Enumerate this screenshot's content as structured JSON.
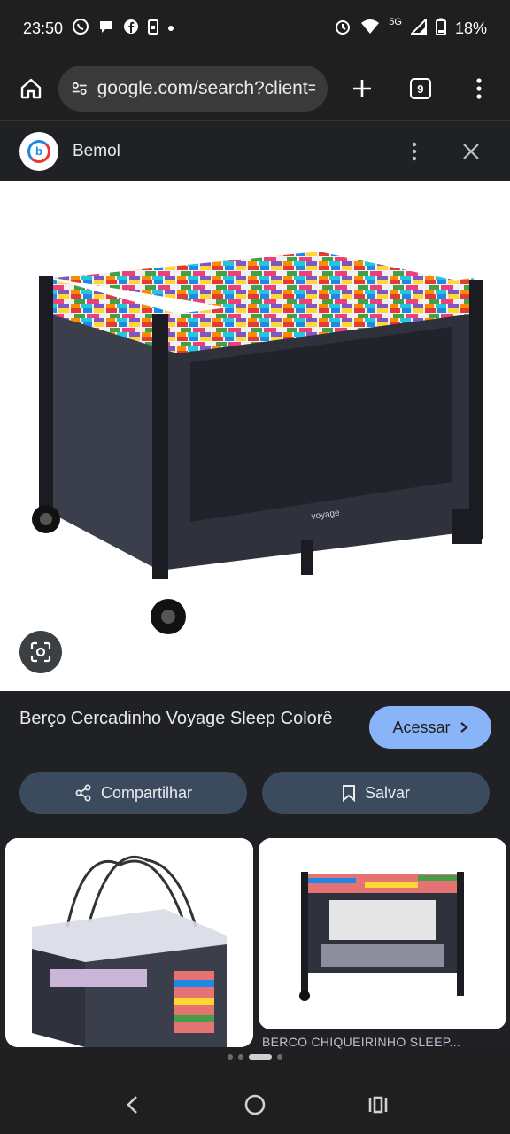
{
  "status": {
    "time": "23:50",
    "network": "5G",
    "battery": "18%"
  },
  "browser": {
    "url": "google.com/search?client=ms",
    "tab_count": "9"
  },
  "source": {
    "name": "Bemol",
    "favicon_letter": "b"
  },
  "result": {
    "title": "Berço Cercadinho Voyage Sleep Colorê",
    "visit_label": "Acessar",
    "share_label": "Compartilhar",
    "save_label": "Salvar",
    "product_brand": "voyage"
  },
  "related": {
    "caption": "BERCO CHIQUEIRINHO SLEEP..."
  },
  "colors": {
    "accent": "#8ab4f8",
    "pill_bg": "#3c4a5e",
    "background": "#202124"
  }
}
